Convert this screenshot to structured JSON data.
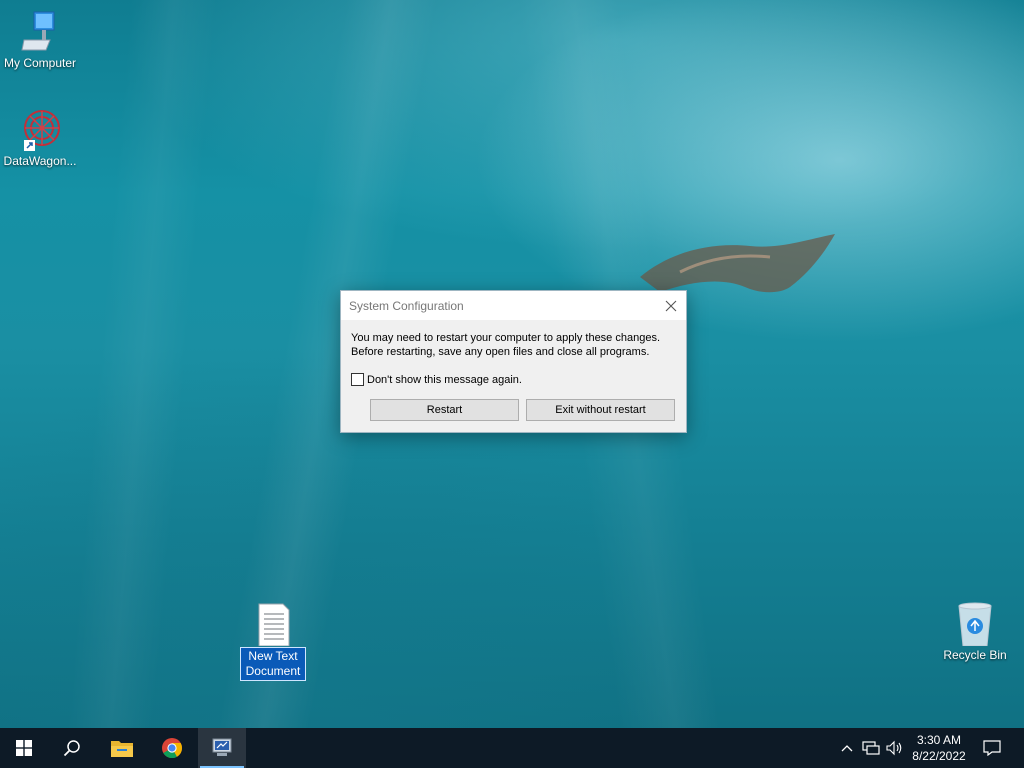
{
  "desktop": {
    "icons": [
      {
        "label": "My Computer",
        "icon": "computer-icon"
      },
      {
        "label": "DataWagon...",
        "icon": "datawagon-icon"
      },
      {
        "label_line1": "New Text",
        "label_line2": "Document",
        "icon": "text-document-icon",
        "selected": true
      },
      {
        "label": "Recycle Bin",
        "icon": "recycle-bin-icon"
      }
    ]
  },
  "dialog": {
    "title": "System Configuration",
    "message_line1": "You may need to restart your computer to apply these changes.",
    "message_line2": "Before restarting, save any open files and close all programs.",
    "checkbox_label": "Don't show this message again.",
    "checkbox_checked": false,
    "restart_label": "Restart",
    "exit_label": "Exit without restart"
  },
  "taskbar": {
    "items": [
      "start-icon",
      "search-icon",
      "file-explorer-icon",
      "chrome-icon",
      "system-configuration-icon"
    ],
    "active_item": "system-configuration-icon",
    "time": "3:30 AM",
    "date": "8/22/2022"
  },
  "colors": {
    "taskbar": "#0d1a26",
    "selection": "#0a5ab8",
    "accent": "#7cc4ff"
  }
}
